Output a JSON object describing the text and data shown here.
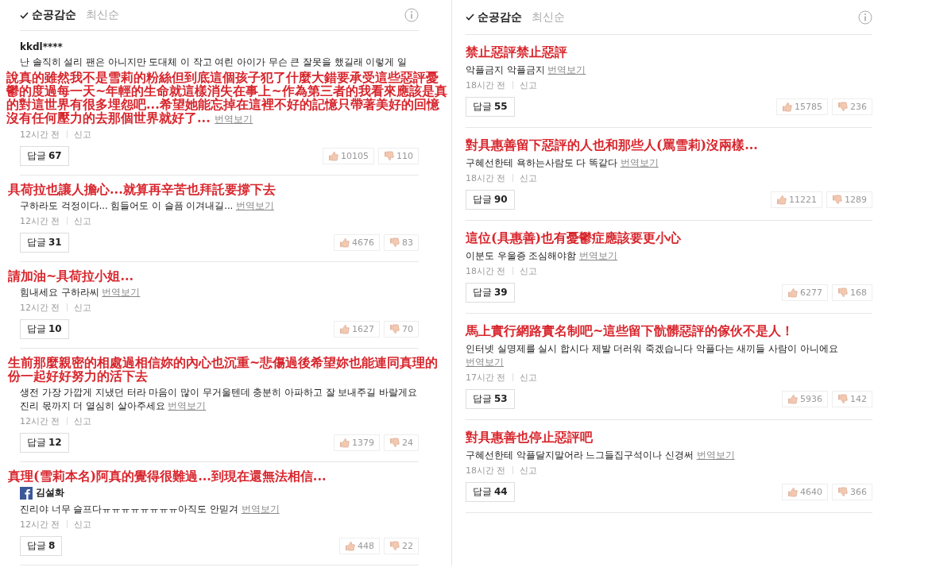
{
  "columns": [
    {
      "sort_options": [
        {
          "label": "순공감순",
          "selected": true
        },
        {
          "label": "최신순",
          "selected": false
        }
      ],
      "comments": [
        {
          "author": {
            "kind": "plain",
            "name": "kkdl****"
          },
          "body": "난 솔직히 설리 팬은 아니지만 도대체 이 작고 여린 아이가 무슨 큰 잘못을 했길래 이렇게 일",
          "annotation": "說真的雖然我不是雪莉的粉絲但到底這個孩子犯了什麼大錯要承受這些惡評憂鬱的度過每一天~年輕的生命就這樣消失在事上~作為第三者的我看來應該是真的對這世界有很多埋怨吧...希望她能忘掉在這裡不好的記憶只帶著美好的回憶沒有任何壓力的去那個世界就好了...",
          "annotation_below": true,
          "translate": "번역보기",
          "time": "12시간 전",
          "report": "신고",
          "reply_label": "답글",
          "reply_count": "67",
          "likes": "10105",
          "dislikes": "110"
        },
        {
          "body": "구하라도 걱정이다... 힘들어도 이 슬픔 이겨내길...",
          "annotation": "具荷拉也讓人擔心...就算再辛苦也拜託要撐下去",
          "annotation_below": false,
          "translate": "번역보기",
          "time": "12시간 전",
          "report": "신고",
          "reply_label": "답글",
          "reply_count": "31",
          "likes": "4676",
          "dislikes": "83"
        },
        {
          "body": "힘내세요 구하라씨",
          "annotation": "請加油~具荷拉小姐...",
          "annotation_below": false,
          "translate": "번역보기",
          "time": "12시간 전",
          "report": "신고",
          "reply_label": "답글",
          "reply_count": "10",
          "likes": "1627",
          "dislikes": "70"
        },
        {
          "body": "생전 가장 가깝게 지냈던 터라 마음이 많이 무거울텐데 충분히 아파하고 잘 보내주길 바랄게요 진리 몫까지 더 열심히 살아주세요",
          "annotation": "生前那麼親密的相處過相信妳的內心也沉重~悲傷過後希望妳也能連同真理的份一起好好努力的活下去",
          "annotation_below": false,
          "translate": "번역보기",
          "time": "12시간 전",
          "report": "신고",
          "reply_label": "답글",
          "reply_count": "12",
          "likes": "1379",
          "dislikes": "24"
        },
        {
          "author": {
            "kind": "social",
            "name": "김설화"
          },
          "body": "진리야 너무 슬프다ㅠㅠㅠㅠㅠㅠㅠㅠ아직도 안믿겨",
          "annotation": "真理(雪莉本名)阿真的覺得很難過...到現在還無法相信...",
          "annotation_below": false,
          "translate": "번역보기",
          "time": "12시간 전",
          "report": "신고",
          "reply_label": "답글",
          "reply_count": "8",
          "likes": "448",
          "dislikes": "22"
        }
      ]
    },
    {
      "sort_options": [
        {
          "label": "순공감순",
          "selected": true
        },
        {
          "label": "최신순",
          "selected": false
        }
      ],
      "comments": [
        {
          "body": "악플금지 악플금지",
          "annotation": "禁止惡評禁止惡評",
          "annotation_below": false,
          "translate": "번역보기",
          "time": "18시간 전",
          "report": "신고",
          "reply_label": "답글",
          "reply_count": "55",
          "likes": "15785",
          "dislikes": "236"
        },
        {
          "body": "구혜선한테 욕하는사람도 다 똑같다",
          "annotation": "對具惠善留下惡評的人也和那些人(罵雪莉)沒兩樣...",
          "annotation_below": false,
          "translate": "번역보기",
          "time": "18시간 전",
          "report": "신고",
          "reply_label": "답글",
          "reply_count": "90",
          "likes": "11221",
          "dislikes": "1289"
        },
        {
          "body": "이분도 우울증 조심해야함",
          "annotation": "這位(具惠善)也有憂鬱症應該要更小心",
          "annotation_below": false,
          "translate": "번역보기",
          "time": "18시간 전",
          "report": "신고",
          "reply_label": "답글",
          "reply_count": "39",
          "likes": "6277",
          "dislikes": "168"
        },
        {
          "body": "인터넷 실명제를 실시 합시다 제발 더러워 죽겠습니다 악플다는 새끼들 사람이 아니에요",
          "annotation": "馬上實行網路實名制吧~這些留下骯髒惡評的傢伙不是人！",
          "annotation_below": false,
          "translate": "번역보기",
          "time": "17시간 전",
          "report": "신고",
          "reply_label": "답글",
          "reply_count": "53",
          "likes": "5936",
          "dislikes": "142"
        },
        {
          "body": "구혜선한테 악플달지말어라 느그들집구석이나 신경써",
          "annotation": "對具惠善也停止惡評吧",
          "annotation_below": false,
          "translate": "번역보기",
          "time": "18시간 전",
          "report": "신고",
          "reply_label": "답글",
          "reply_count": "44",
          "likes": "4640",
          "dislikes": "366"
        }
      ]
    }
  ]
}
